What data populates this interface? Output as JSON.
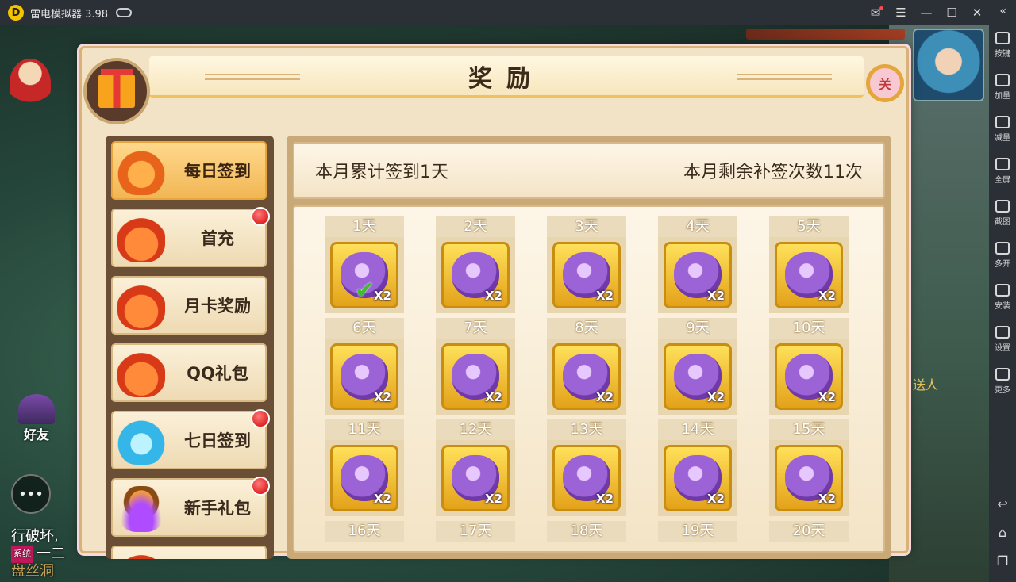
{
  "titlebar": {
    "logo": "D",
    "app_title": "雷电模拟器 3.98",
    "icons": [
      "gamepad-icon",
      "mail-icon",
      "menu-icon",
      "minimize-icon",
      "maximize-icon",
      "close-icon",
      "collapse-icon"
    ]
  },
  "sidebar": {
    "items": [
      {
        "label": "按键",
        "icon": "keyboard-icon"
      },
      {
        "label": "加量",
        "icon": "volume-up-icon"
      },
      {
        "label": "减量",
        "icon": "volume-down-icon"
      },
      {
        "label": "全屏",
        "icon": "fullscreen-icon"
      },
      {
        "label": "截图",
        "icon": "scissors-icon"
      },
      {
        "label": "多开",
        "icon": "multi-instance-icon"
      },
      {
        "label": "安装",
        "icon": "apk-install-icon"
      },
      {
        "label": "设置",
        "icon": "gear-icon"
      },
      {
        "label": "更多",
        "icon": "more-icon"
      }
    ],
    "nav": {
      "back": "↩",
      "home": "⌂",
      "recent": "❐"
    }
  },
  "game": {
    "friend_label": "好友",
    "chat_icon": "•••",
    "chat_lines": [
      "行破坏,",
      "一二"
    ],
    "chat_tag": "系统",
    "chat_partial": "盘丝洞",
    "npc_partial": "送人"
  },
  "panel": {
    "title": "奖励",
    "close_label": "关",
    "menu": [
      {
        "label": "每日签到",
        "icon": "orange-pouch-icon",
        "active": true,
        "badge": false
      },
      {
        "label": "首充",
        "icon": "red-money-bag-icon",
        "active": false,
        "badge": true
      },
      {
        "label": "月卡奖励",
        "icon": "red-money-bag-icon",
        "active": false,
        "badge": false
      },
      {
        "label": "QQ礼包",
        "icon": "red-money-bag-icon",
        "active": false,
        "badge": false
      },
      {
        "label": "七日签到",
        "icon": "blue-money-bag-icon",
        "active": false,
        "badge": true
      },
      {
        "label": "新手礼包",
        "icon": "crystal-treasure-icon",
        "active": false,
        "badge": true
      }
    ],
    "summary": {
      "left": "本月累计签到1天",
      "right": "本月剩余补签次数11次"
    },
    "days": [
      {
        "label": "1天",
        "count": "X2",
        "claimed": true
      },
      {
        "label": "2天",
        "count": "X2",
        "claimed": false
      },
      {
        "label": "3天",
        "count": "X2",
        "claimed": false
      },
      {
        "label": "4天",
        "count": "X2",
        "claimed": false
      },
      {
        "label": "5天",
        "count": "X2",
        "claimed": false
      },
      {
        "label": "6天",
        "count": "X2",
        "claimed": false
      },
      {
        "label": "7天",
        "count": "X2",
        "claimed": false
      },
      {
        "label": "8天",
        "count": "X2",
        "claimed": false
      },
      {
        "label": "9天",
        "count": "X2",
        "claimed": false
      },
      {
        "label": "10天",
        "count": "X2",
        "claimed": false
      },
      {
        "label": "11天",
        "count": "X2",
        "claimed": false
      },
      {
        "label": "12天",
        "count": "X2",
        "claimed": false
      },
      {
        "label": "13天",
        "count": "X2",
        "claimed": false
      },
      {
        "label": "14天",
        "count": "X2",
        "claimed": false
      },
      {
        "label": "15天",
        "count": "X2",
        "claimed": false
      },
      {
        "label": "16天"
      },
      {
        "label": "17天"
      },
      {
        "label": "18天"
      },
      {
        "label": "19天"
      },
      {
        "label": "20天"
      }
    ]
  }
}
